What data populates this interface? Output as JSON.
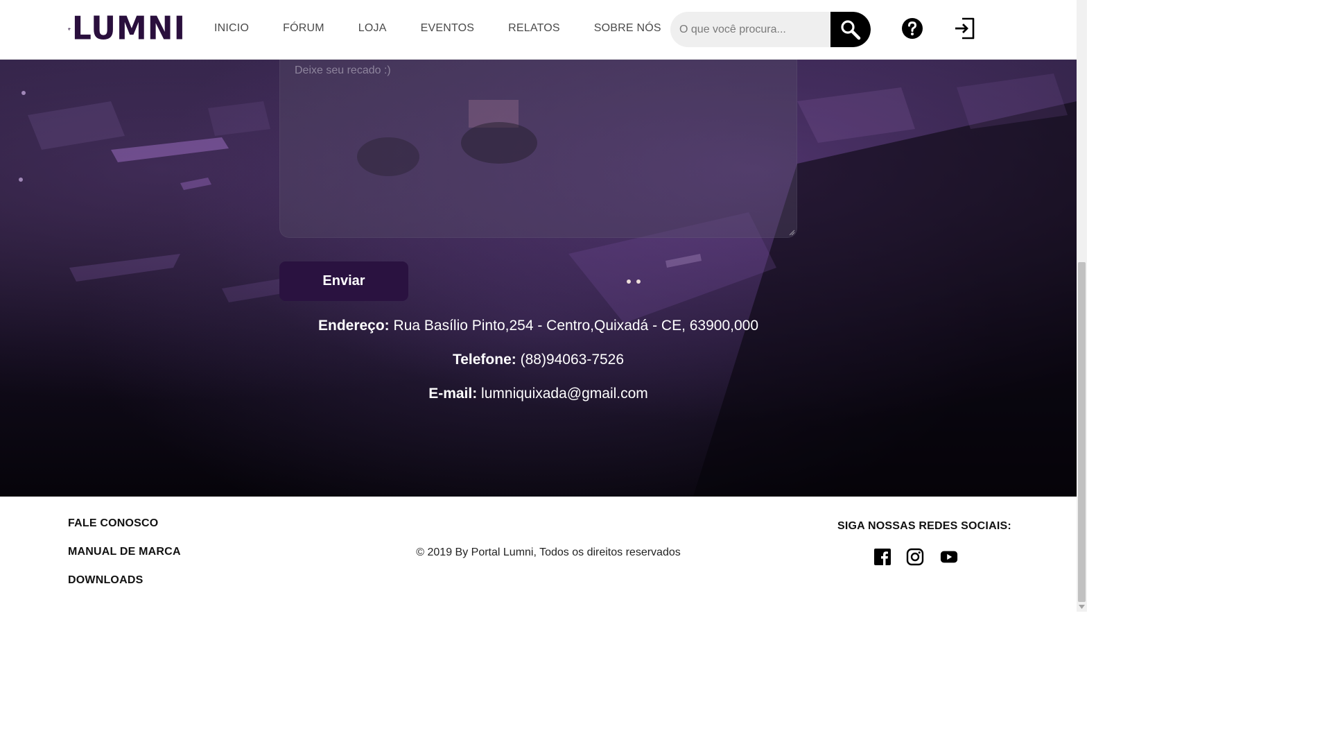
{
  "header": {
    "logo_text": "LUMNI",
    "nav": [
      "INICIO",
      "FÓRUM",
      "LOJA",
      "EVENTOS",
      "RELATOS",
      "SOBRE NÓS"
    ],
    "search_placeholder": "O que você procura...",
    "icons": [
      "search-icon",
      "help-icon",
      "login-icon"
    ]
  },
  "contact": {
    "message_placeholder": "Deixe seu recado :)",
    "send_label": "Enviar",
    "address_label": "Endereço:",
    "address_value": "Rua Basílio Pinto,254 - Centro,Quixadá - CE, 63900,000",
    "phone_label": "Telefone:",
    "phone_value": "(88)94063-7526",
    "email_label": "E-mail:",
    "email_value": "lumniquixada@gmail.com"
  },
  "footer": {
    "links": [
      "FALE CONOSCO",
      "MANUAL DE MARCA",
      "DOWNLOADS"
    ],
    "copyright": "© 2019 By Portal Lumni, Todos os direitos reservados",
    "social_title": "SIGA NOSSAS REDES SOCIAIS:",
    "social_icons": [
      "facebook-icon",
      "instagram-icon",
      "youtube-icon"
    ]
  },
  "colors": {
    "brand": "#2a0f3d",
    "button": "#2a1240",
    "search_button": "#000000"
  }
}
